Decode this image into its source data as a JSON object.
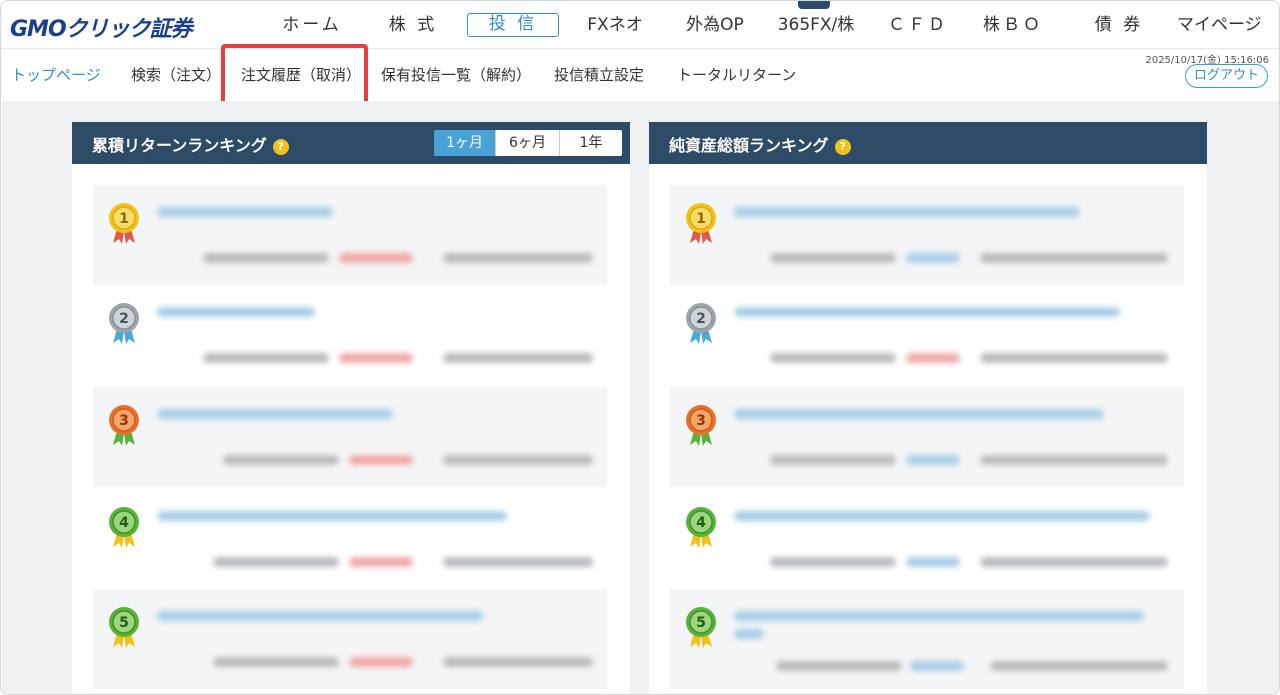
{
  "brand": {
    "logo_text": "GMOクリック証券"
  },
  "nav": {
    "items": [
      {
        "label": "ホーム"
      },
      {
        "label": "株 式"
      },
      {
        "label": "投 信"
      },
      {
        "label": "FXネオ"
      },
      {
        "label": "外為OP"
      },
      {
        "label": "365FX/株"
      },
      {
        "label": "ＣＦＤ"
      },
      {
        "label": "株ＢＯ"
      },
      {
        "label": "債 券"
      },
      {
        "label": "マイページ"
      }
    ],
    "active_index": 2
  },
  "subnav": {
    "items": [
      {
        "label": "トップページ"
      },
      {
        "label": "検索（注文）"
      },
      {
        "label": "注文履歴（取消）"
      },
      {
        "label": "保有投信一覧（解約）"
      },
      {
        "label": "投信積立設定"
      },
      {
        "label": "トータルリターン"
      }
    ],
    "highlighted_index": 2
  },
  "session": {
    "datetime": "2025/10/17(金) 15:16:06",
    "logout_label": "ログアウト"
  },
  "panels": {
    "cumulative": {
      "title": "累積リターンランキング",
      "help": "?",
      "period_tabs": [
        "1ヶ月",
        "6ヶ月",
        "1年"
      ],
      "active_period": 0,
      "ranks": [
        "1",
        "2",
        "3",
        "4",
        "5"
      ]
    },
    "net_assets": {
      "title": "純資産総額ランキング",
      "help": "?",
      "ranks": [
        "1",
        "2",
        "3",
        "4",
        "5"
      ]
    }
  },
  "colors": {
    "accent": "#2f8fc7",
    "header_bg": "#2d4a66",
    "highlight": "#e63e3e",
    "gold": "#f2c218",
    "silver": "#9aa5ad",
    "bronze": "#e8722c",
    "green": "#58b23a"
  }
}
